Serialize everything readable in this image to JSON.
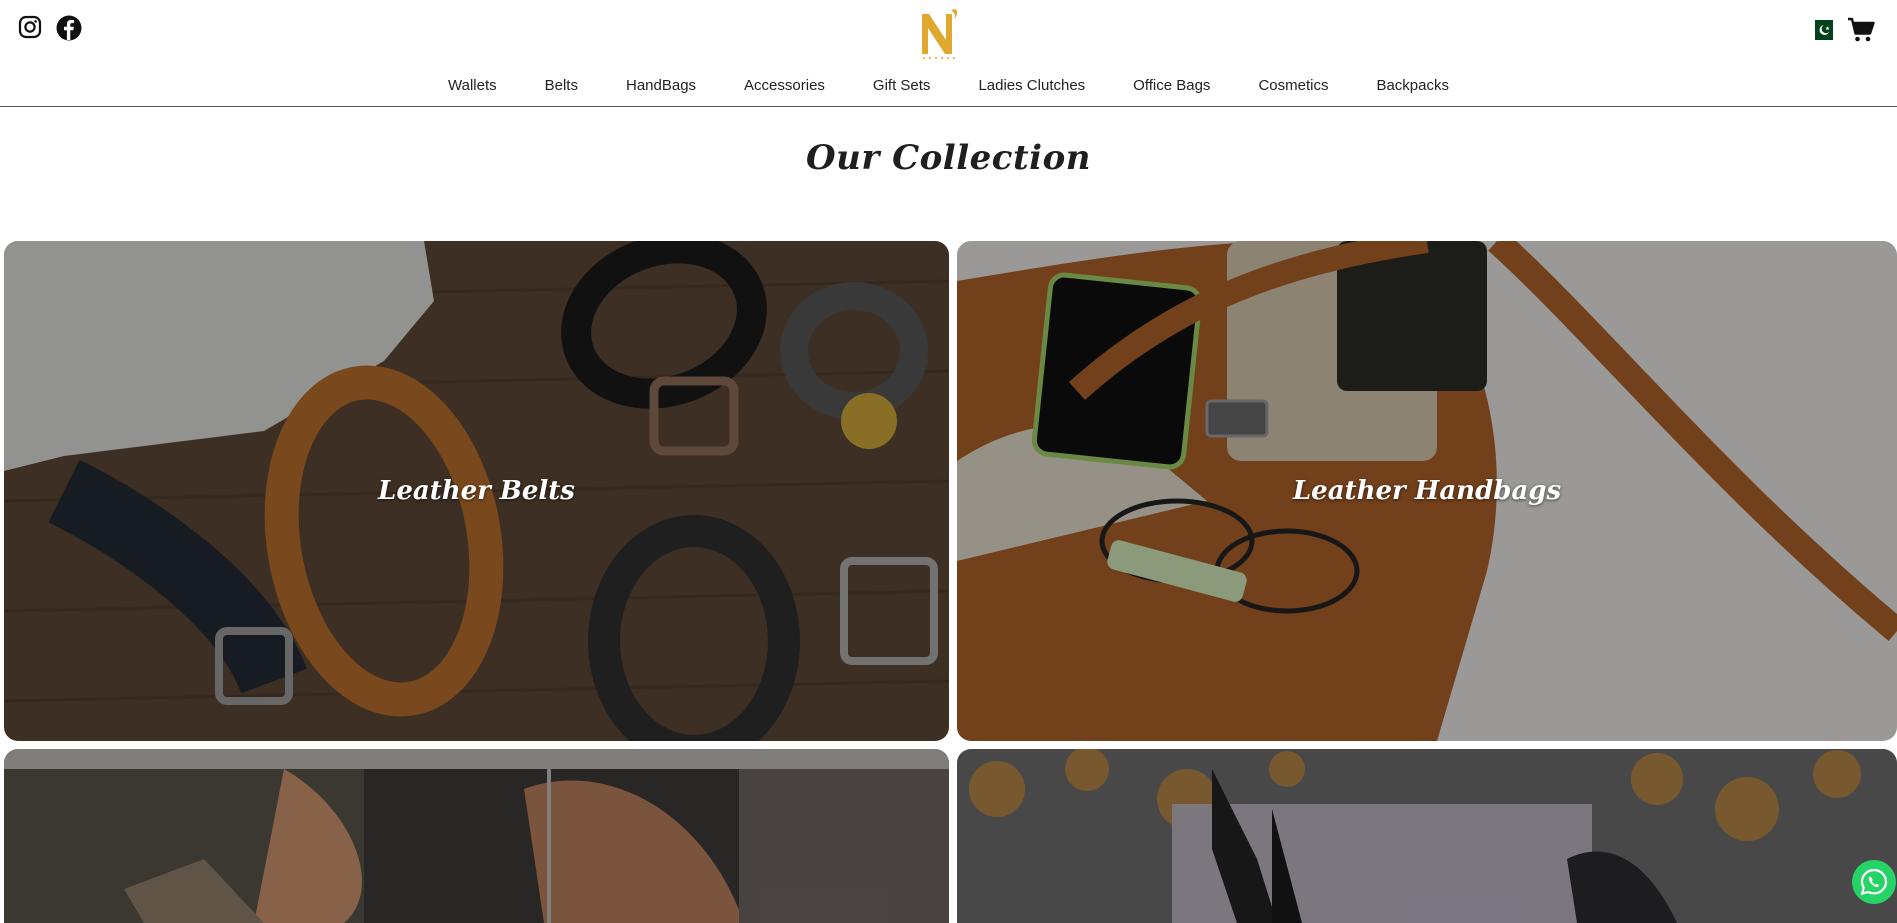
{
  "header": {
    "social": [
      {
        "name": "instagram-icon"
      },
      {
        "name": "facebook-icon"
      }
    ],
    "logo_letter": "N",
    "logo_color": "#e0a82e",
    "country_flag": "pakistan-flag-icon",
    "cart_icon": "cart-icon"
  },
  "nav": {
    "items": [
      {
        "label": "Wallets"
      },
      {
        "label": "Belts"
      },
      {
        "label": "HandBags"
      },
      {
        "label": "Accessories"
      },
      {
        "label": "Gift Sets"
      },
      {
        "label": "Ladies Clutches"
      },
      {
        "label": "Office Bags"
      },
      {
        "label": "Cosmetics"
      },
      {
        "label": "Backpacks"
      }
    ]
  },
  "collection": {
    "title": "Our Collection",
    "cards": [
      {
        "label": "Leather Belts"
      },
      {
        "label": "Leather Handbags"
      },
      {
        "label": ""
      },
      {
        "label": ""
      }
    ]
  },
  "floating": {
    "whatsapp_icon": "whatsapp-icon",
    "whatsapp_color": "#25d366"
  }
}
